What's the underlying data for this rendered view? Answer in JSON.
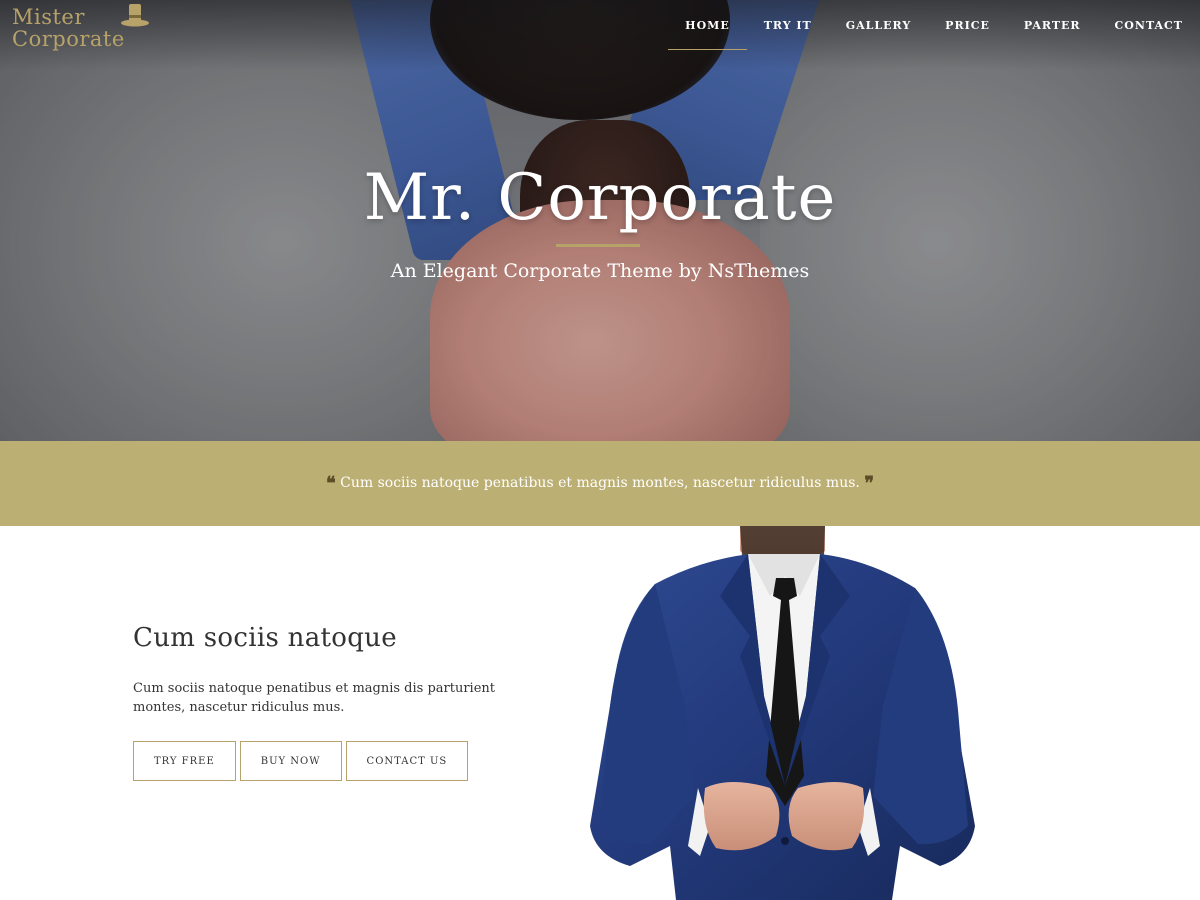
{
  "logo": {
    "line1": "Mister",
    "line2": "Corporate"
  },
  "nav": {
    "items": [
      {
        "label": "HOME",
        "active": true
      },
      {
        "label": "TRY IT"
      },
      {
        "label": "GALLERY"
      },
      {
        "label": "PRICE"
      },
      {
        "label": "PARTER"
      },
      {
        "label": "CONTACT"
      }
    ]
  },
  "hero": {
    "title": "Mr. Corporate",
    "subtitle": "An Elegant Corporate Theme by NsThemes"
  },
  "quote": {
    "open_mark": "❝",
    "text": "Cum sociis natoque penatibus et magnis montes, nascetur ridiculus mus.",
    "close_mark": "❞"
  },
  "feature": {
    "title": "Cum sociis natoque",
    "text": "Cum sociis natoque penatibus et magnis dis parturient montes, nascetur ridiculus mus.",
    "buttons": [
      "TRY FREE",
      "BUY NOW",
      "CONTACT US"
    ]
  },
  "colors": {
    "accent": "#b7a26a",
    "quote_band": "#bcaf74",
    "text_dark": "#333333",
    "suit_blue": "#22397a"
  },
  "icons": {
    "logo_icon": "top-hat-icon",
    "quote_open": "quote-open-icon",
    "quote_close": "quote-close-icon"
  }
}
